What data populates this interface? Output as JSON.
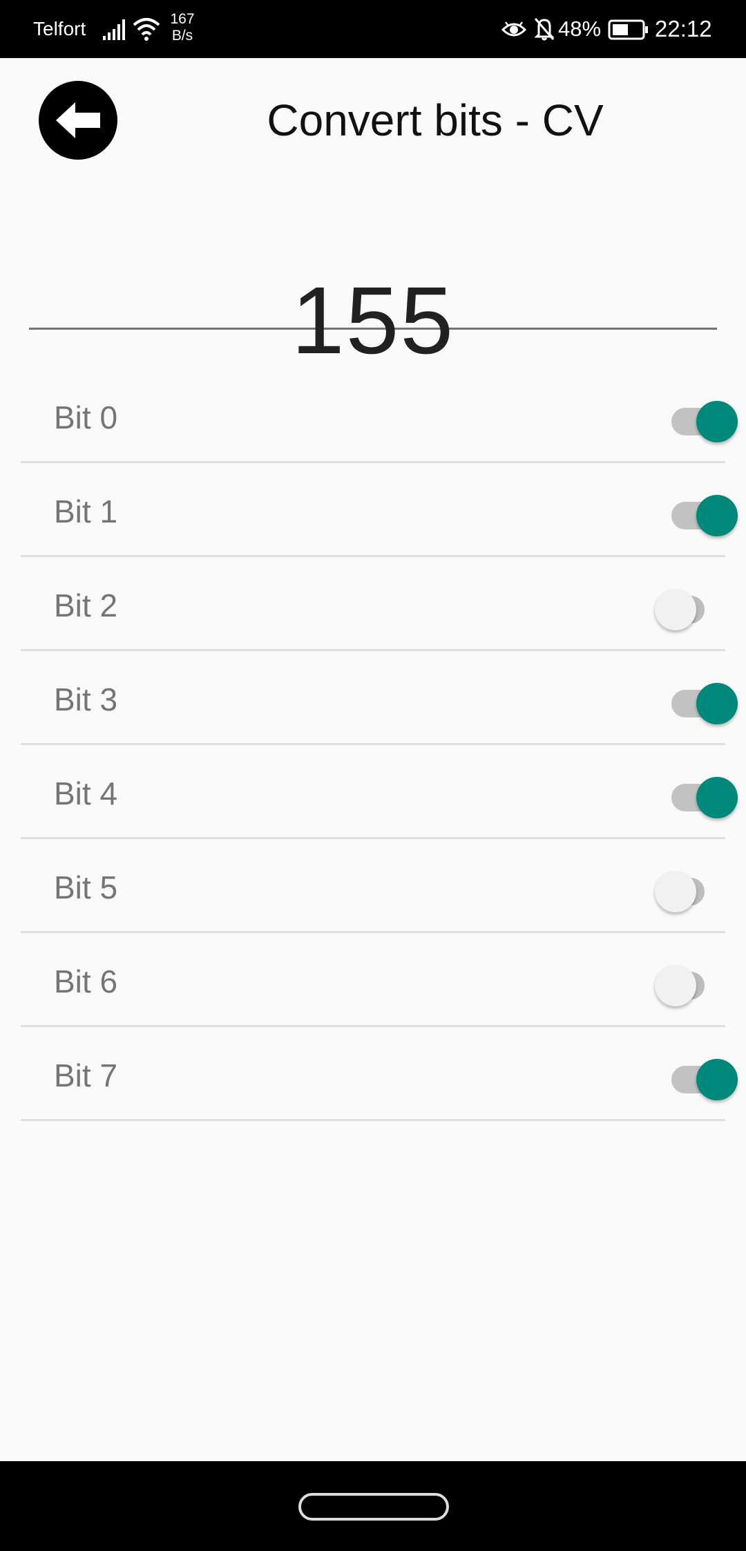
{
  "status_bar": {
    "carrier": "Telfort",
    "net_speed_value": "167",
    "net_speed_unit": "B/s",
    "battery_percent": "48%",
    "time": "22:12",
    "icons": [
      "signal-icon",
      "wifi-icon",
      "eye-icon",
      "bell-off-icon",
      "battery-icon"
    ]
  },
  "header": {
    "back_icon": "arrow-left-icon",
    "title": "Convert bits - CV"
  },
  "value_field": {
    "value": "155"
  },
  "bits": [
    {
      "label": "Bit 0",
      "on": true
    },
    {
      "label": "Bit 1",
      "on": true
    },
    {
      "label": "Bit 2",
      "on": false
    },
    {
      "label": "Bit 3",
      "on": true
    },
    {
      "label": "Bit 4",
      "on": true
    },
    {
      "label": "Bit 5",
      "on": false
    },
    {
      "label": "Bit 6",
      "on": false
    },
    {
      "label": "Bit 7",
      "on": true
    }
  ],
  "colors": {
    "accent": "#00897b",
    "switch_off_thumb": "#f1f1f1",
    "track": "#bdbdbd",
    "background": "#fafafa",
    "system_bars": "#000000"
  },
  "nav_bar": {
    "home_icon": "home-pill-icon"
  }
}
